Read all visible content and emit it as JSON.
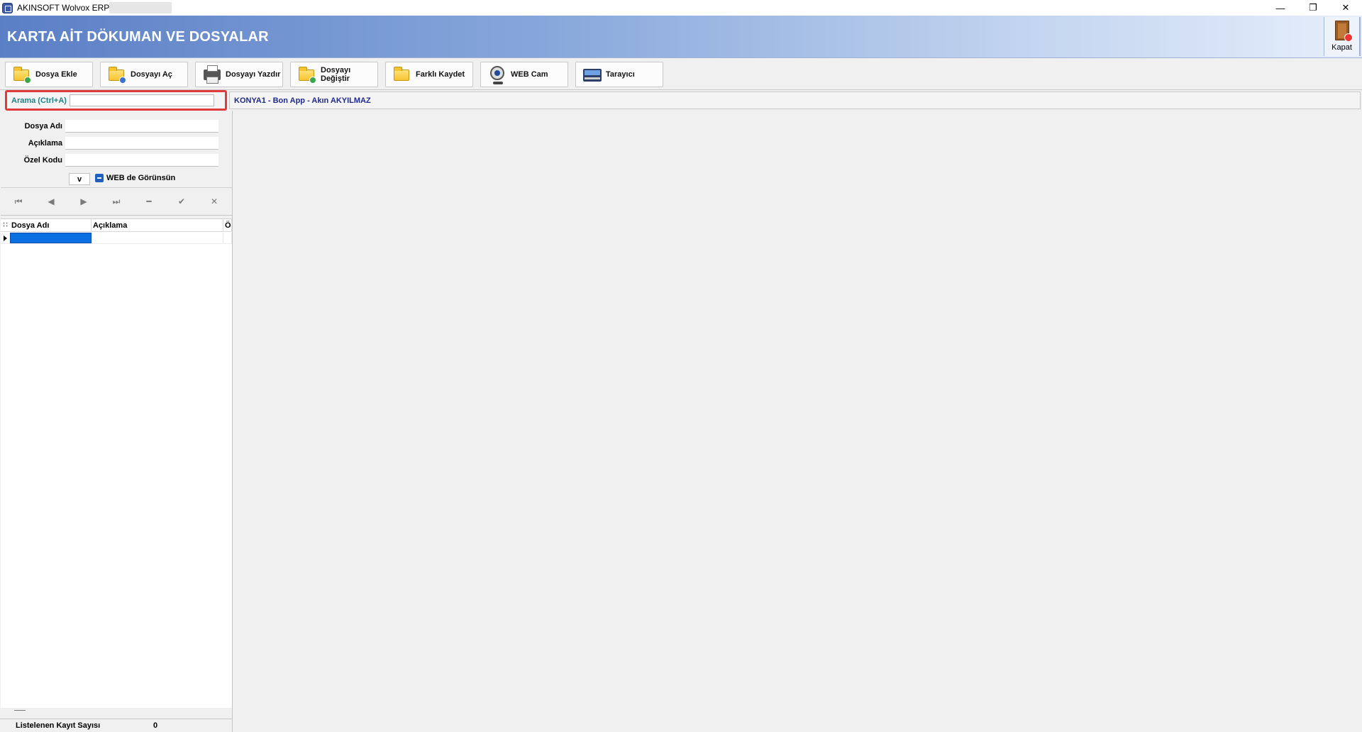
{
  "window": {
    "title": "AKINSOFT Wolvox ERP",
    "minimize": "—",
    "maximize": "❐",
    "close": "✕"
  },
  "banner": {
    "title": "KARTA AİT DÖKUMAN VE DOSYALAR",
    "close_label": "Kapat"
  },
  "toolbar": {
    "buttons": [
      {
        "label": "Dosya Ekle",
        "icon": "folder-add-icon"
      },
      {
        "label": "Dosyayı Aç",
        "icon": "folder-search-icon"
      },
      {
        "label": "Dosyayı Yazdır",
        "icon": "printer-icon"
      },
      {
        "label": "Dosyayı Değiştir",
        "icon": "folder-replace-icon"
      },
      {
        "label": "Farklı Kaydet",
        "icon": "save-as-icon"
      },
      {
        "label": "WEB Cam",
        "icon": "webcam-icon"
      },
      {
        "label": "Tarayıcı",
        "icon": "scanner-icon"
      }
    ]
  },
  "search": {
    "label": "Arama (Ctrl+A)",
    "value": ""
  },
  "info": {
    "text": "KONYA1 - Bon App - Akın AKYILMAZ"
  },
  "form": {
    "fields": [
      {
        "label": "Dosya Adı",
        "value": ""
      },
      {
        "label": "Açıklama",
        "value": ""
      },
      {
        "label": "Özel Kodu",
        "value": ""
      }
    ],
    "dropdown_label": "v",
    "checkbox_label": "WEB de Görünsün",
    "checkbox_state": "indeterminate"
  },
  "navigator": {
    "first": "⏮",
    "prior": "◀",
    "next": "▶",
    "last": "⏭",
    "delete": "━",
    "post": "✔",
    "cancel": "✕"
  },
  "grid": {
    "columns": [
      "Dosya Adı",
      "Açıklama",
      "Öz"
    ],
    "rows": [
      {
        "dosya_adi": "",
        "aciklama": "",
        "ozel": ""
      }
    ]
  },
  "footer": {
    "label": "Listelenen Kayıt Sayısı",
    "count": "0"
  },
  "colors": {
    "banner_start": "#5b7fc6",
    "search_highlight": "#e03a3a",
    "search_label": "#1e7f86",
    "info_text": "#1f2a8a",
    "selection": "#0a6fe0"
  }
}
